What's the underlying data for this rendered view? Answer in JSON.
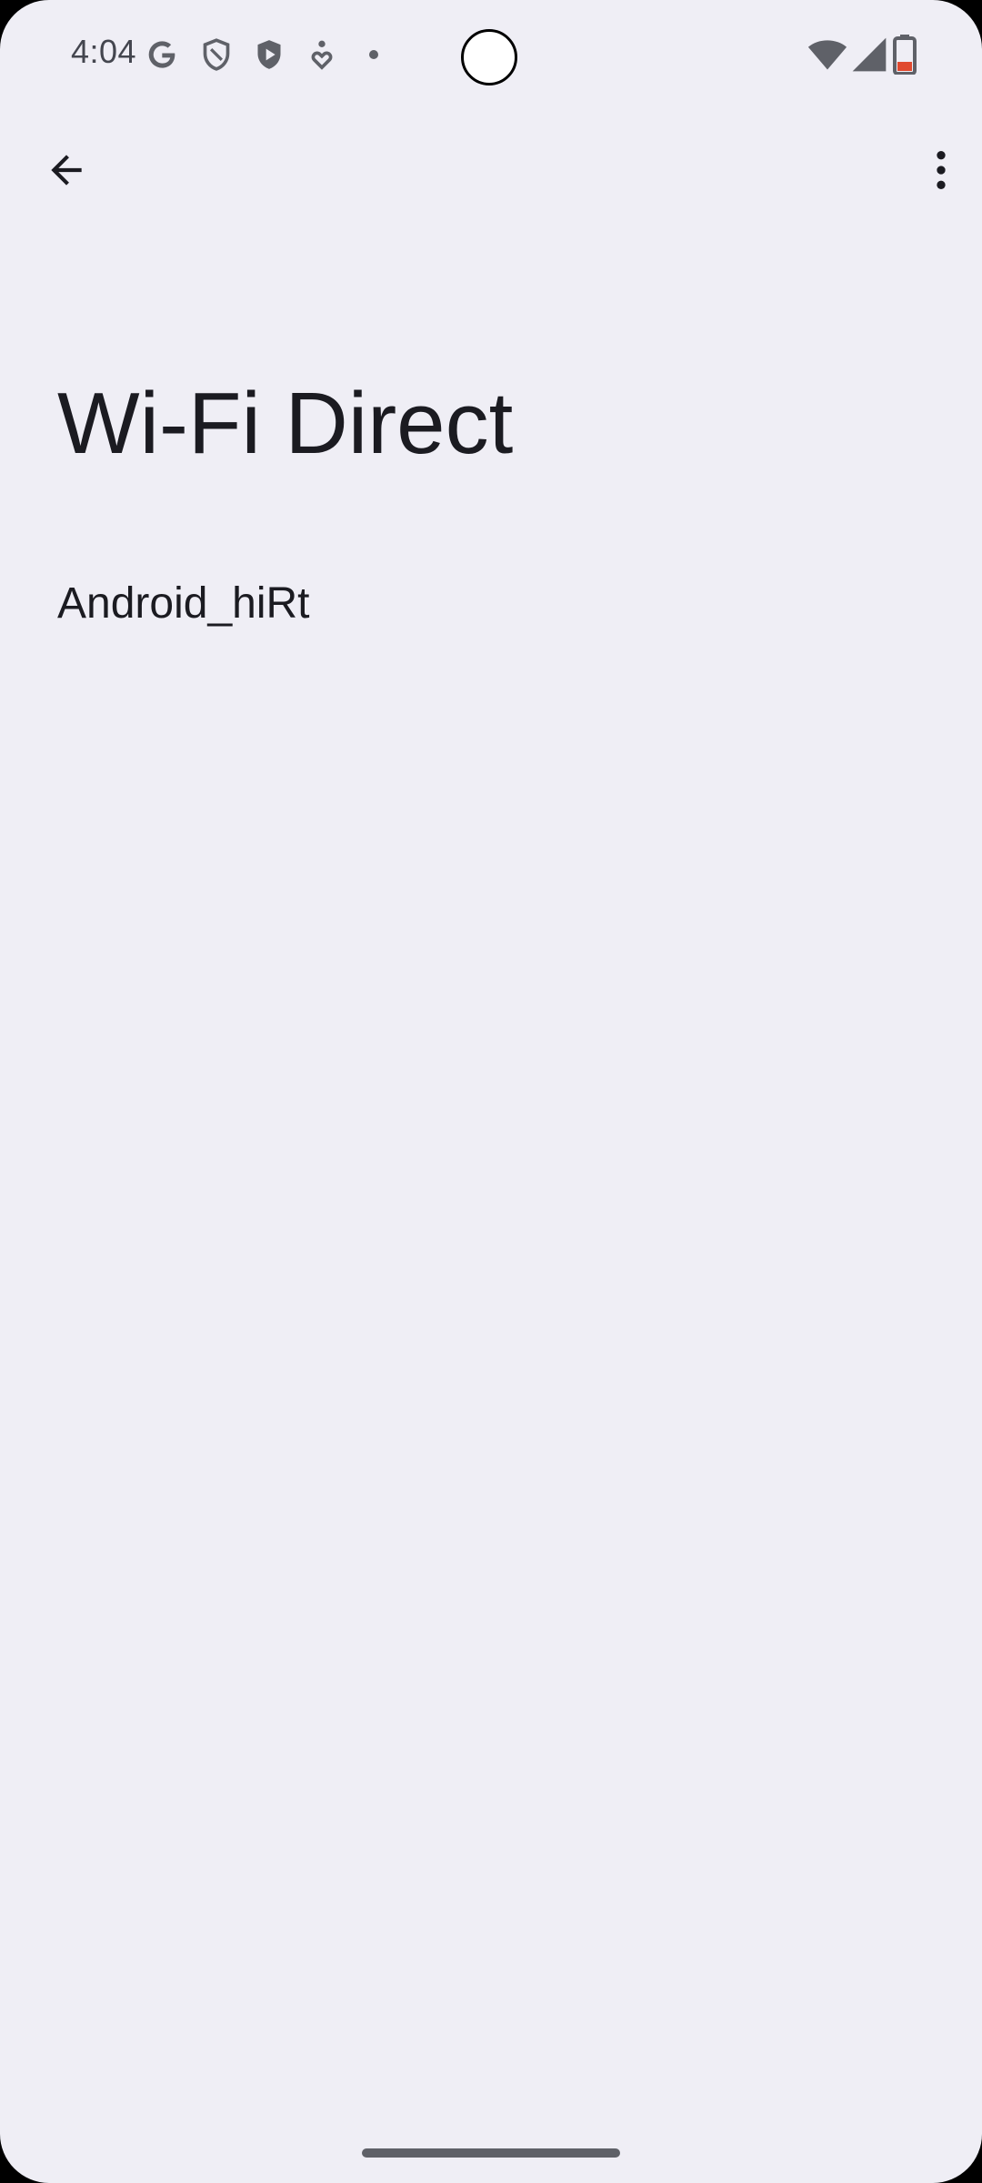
{
  "status_bar": {
    "time": "4:04",
    "icons": [
      "google-g-icon",
      "shield-outline-icon",
      "shield-play-icon",
      "accessibility-heart-icon",
      "notification-dot-icon",
      "wifi-icon",
      "cell-signal-icon",
      "battery-icon"
    ]
  },
  "app_bar": {
    "back_icon": "arrow-left-icon",
    "more_icon": "more-vertical-icon"
  },
  "page": {
    "title": "Wi-Fi Direct",
    "device_name": "Android_hiRt"
  },
  "colors": {
    "background": "#efeef5",
    "text_primary": "#1b1b21",
    "status_icon": "#5f6168",
    "battery_low": "#e0492f"
  }
}
